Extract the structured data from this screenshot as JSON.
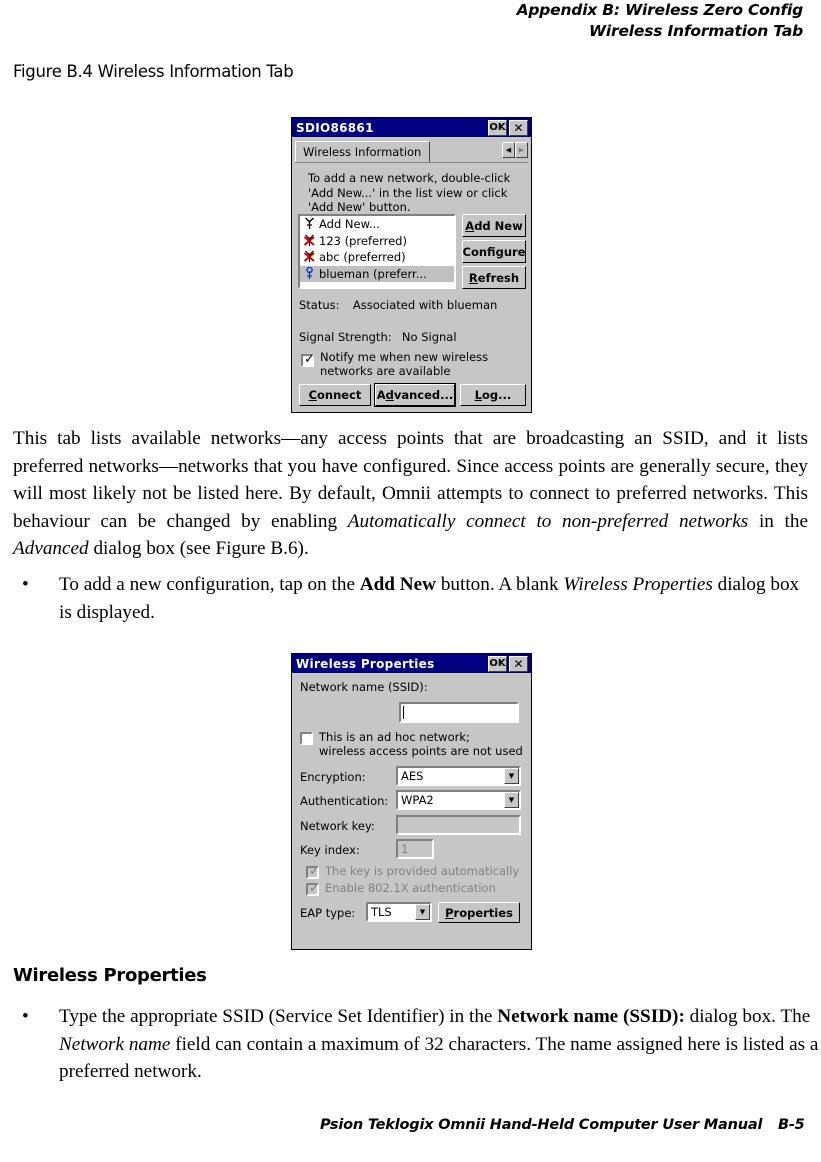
{
  "header": {
    "line1": "Appendix B:  Wireless Zero Config",
    "line2": "Wireless Information Tab"
  },
  "figure_caption": "Figure B.4  Wireless Information Tab",
  "section_heading": "Wireless Properties",
  "paragraphs": {
    "intro_p1": "This tab lists available networks—any access points that are broadcasting an SSID, and it lists preferred networks—networks that you have configured. Since access points are generally secure, they will most likely not be listed here. By default, Omnii attempts to connect to preferred networks. This behaviour can be changed by enabling ",
    "intro_p1_italic1": "Automatically connect to non-preferred networks",
    "intro_p1_mid": " in the ",
    "intro_p1_italic2": "Advanced",
    "intro_p1_end": " dialog box (see Figure B.6).",
    "bullet1_mark": "•",
    "bullet1_a": "To add a new configuration, tap on the ",
    "bullet1_bold": "Add New",
    "bullet1_b": " button. A blank ",
    "bullet1_italic": "Wireless Properties",
    "bullet1_c": " dialog box is displayed.",
    "bullet2_mark": "•",
    "bullet2_a": "Type the appropriate SSID (Service Set Identifier) in the ",
    "bullet2_bold": "Network name (SSID):",
    "bullet2_b": " dialog box. The ",
    "bullet2_italic": "Network name",
    "bullet2_c": " field can contain a maximum of 32 characters. The name assigned here is listed as a preferred network."
  },
  "footer": {
    "manual": "Psion Teklogix Omnii Hand-Held Computer User Manual",
    "page": "B-5"
  },
  "colors": {
    "titlebar": "#000080",
    "dialog_face": "#c6c6c6",
    "selection": "#c0c0c0",
    "icon_red": "#cc0000",
    "icon_blue": "#0033cc",
    "disabled_text": "#808080"
  },
  "dialog_wireless_info": {
    "title": "SDIO86861",
    "ok_label": "OK",
    "close_label": "✕",
    "tab_label": "Wireless Information",
    "spin_left": "◀",
    "spin_right": "▶",
    "instructions": "To add a new network, double-click\n'Add New...' in the list view or click\n'Add New' button.",
    "network_list": [
      {
        "label": "Add New...",
        "icon": "antenna-plain-icon",
        "selected": false
      },
      {
        "label": "123 (preferred)",
        "icon": "antenna-red-x-icon",
        "selected": false
      },
      {
        "label": "abc (preferred)",
        "icon": "antenna-red-x-icon",
        "selected": false
      },
      {
        "label": "blueman (preferr...",
        "icon": "antenna-blue-icon",
        "selected": true
      }
    ],
    "buttons": {
      "add_new": "Add New",
      "configure": "Configure",
      "refresh": "Refresh",
      "connect": "Connect",
      "advanced": "Advanced...",
      "log": "Log..."
    },
    "status_label": "Status:",
    "status_value": "Associated with blueman",
    "signal_label": "Signal Strength:",
    "signal_value": "No Signal",
    "notify_checkbox": {
      "line1": "Notify me when new wireless",
      "line2": "networks are available",
      "checked": true
    }
  },
  "dialog_wireless_properties": {
    "title": "Wireless Properties",
    "ok_label": "OK",
    "close_label": "✕",
    "ssid_label": "Network name (SSID):",
    "ssid_value": "",
    "adhoc_checkbox": {
      "line1": "This is an ad hoc network;",
      "line2": "wireless access points are not used",
      "checked": false
    },
    "encryption_label": "Encryption:",
    "encryption_value": "AES",
    "authentication_label": "Authentication:",
    "authentication_value": "WPA2",
    "network_key_label": "Network key:",
    "network_key_value": "",
    "key_index_label": "Key index:",
    "key_index_value": "1",
    "key_auto_label": "The key is provided automatically",
    "key_auto_checked": true,
    "enable_8021x_label": "Enable 802.1X authentication",
    "enable_8021x_checked": true,
    "eap_label": "EAP type:",
    "eap_value": "TLS",
    "properties_button": "Properties",
    "dropdown_arrow": "▼"
  }
}
